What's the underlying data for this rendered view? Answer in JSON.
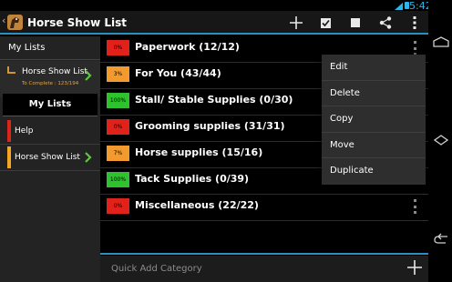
{
  "statusbar": {
    "time": "5:42"
  },
  "actionbar": {
    "title": "Horse Show List",
    "icons": [
      "add-icon",
      "checkbox-checked-icon",
      "checkbox-unchecked-icon",
      "share-icon",
      "overflow-icon"
    ]
  },
  "drawer": {
    "header": "My Lists",
    "selected": {
      "title": "Horse Show List",
      "subtitle": "To Complete : 123/194"
    },
    "mylists_button": "My Lists",
    "items": [
      {
        "label": "Help",
        "color": "#d9261c"
      },
      {
        "label": "Horse Show List",
        "color": "#f5a623"
      }
    ]
  },
  "categories": [
    {
      "pct": "0%",
      "label": "Paperwork (12/12)",
      "color": "#e0221b"
    },
    {
      "pct": "3%",
      "label": "For You (43/44)",
      "color": "#f29a2e"
    },
    {
      "pct": "100%",
      "label": "Stall/ Stable Supplies (0/30)",
      "color": "#2fc22f"
    },
    {
      "pct": "0%",
      "label": "Grooming supplies (31/31)",
      "color": "#e0221b"
    },
    {
      "pct": "7%",
      "label": "Horse supplies (15/16)",
      "color": "#f29a2e"
    },
    {
      "pct": "100%",
      "label": "Tack Supplies (0/39)",
      "color": "#2fc22f"
    },
    {
      "pct": "0%",
      "label": "Miscellaneous (22/22)",
      "color": "#e0221b"
    }
  ],
  "quickadd": {
    "placeholder": "Quick Add Category"
  },
  "popup_menu": [
    "Edit",
    "Delete",
    "Copy",
    "Move",
    "Duplicate"
  ],
  "colors": {
    "accent": "#2b8fc4",
    "red": "#e0221b",
    "orange": "#f29a2e",
    "green": "#2fc22f"
  }
}
